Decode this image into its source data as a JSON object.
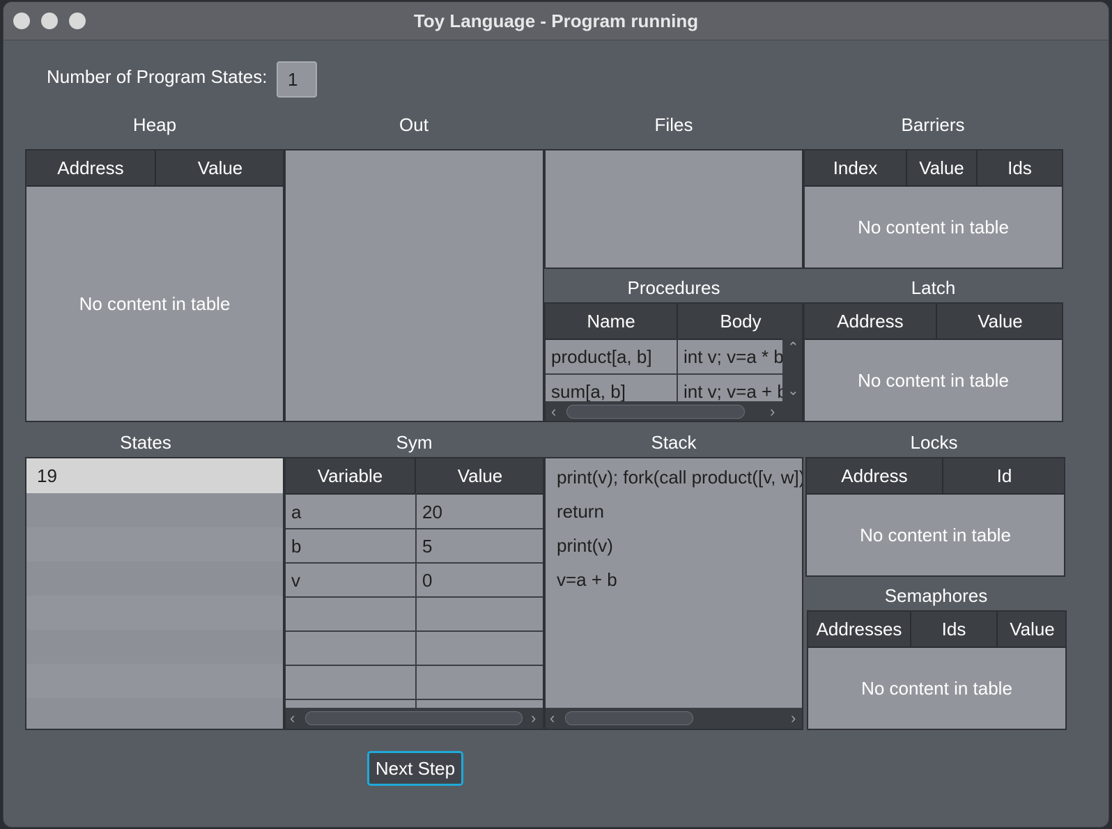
{
  "window": {
    "title": "Toy Language - Program running"
  },
  "states_count": {
    "label": "Number of Program States:",
    "value": "1"
  },
  "heap": {
    "title": "Heap",
    "columns": [
      "Address",
      "Value"
    ],
    "empty_text": "No content in table"
  },
  "out": {
    "title": "Out"
  },
  "files": {
    "title": "Files"
  },
  "barriers": {
    "title": "Barriers",
    "columns": [
      "Index",
      "Value",
      "Ids"
    ],
    "empty_text": "No content in table"
  },
  "procedures": {
    "title": "Procedures",
    "columns": [
      "Name",
      "Body"
    ],
    "rows": [
      {
        "name": "product[a, b]",
        "body": "int v; v=a * b;"
      },
      {
        "name": "sum[a, b]",
        "body": "int v; v=a + b;"
      }
    ]
  },
  "latch": {
    "title": "Latch",
    "columns": [
      "Address",
      "Value"
    ],
    "empty_text": "No content in table"
  },
  "states": {
    "title": "States",
    "items": [
      "19"
    ]
  },
  "sym": {
    "title": "Sym",
    "columns": [
      "Variable",
      "Value"
    ],
    "rows": [
      {
        "variable": "a",
        "value": "20"
      },
      {
        "variable": "b",
        "value": "5"
      },
      {
        "variable": "v",
        "value": "0"
      }
    ]
  },
  "stack": {
    "title": "Stack",
    "items": [
      "print(v); fork(call product([v, w]); f",
      "return",
      "print(v)",
      "v=a + b"
    ]
  },
  "locks": {
    "title": "Locks",
    "columns": [
      "Address",
      "Id"
    ],
    "empty_text": "No content in table"
  },
  "semaphores": {
    "title": "Semaphores",
    "columns": [
      "Addresses",
      "Ids",
      "Value"
    ],
    "empty_text": "No content in table"
  },
  "next_step": {
    "label": "Next Step"
  },
  "colors": {
    "accent": "#1fa9d9",
    "window_bg": "#575c63",
    "panel_bg": "#92969c",
    "header_bg": "#3c4045"
  }
}
